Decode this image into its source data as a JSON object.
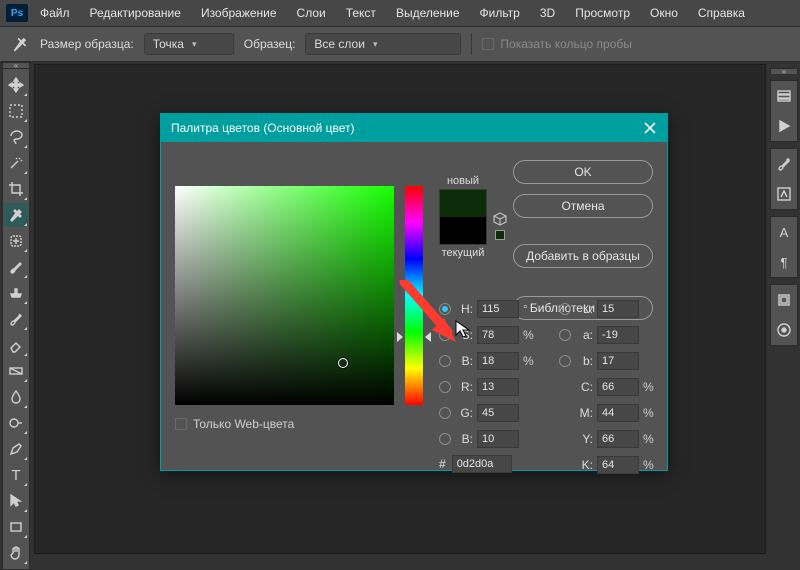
{
  "menubar": {
    "logo": "Ps",
    "items": [
      "Файл",
      "Редактирование",
      "Изображение",
      "Слои",
      "Текст",
      "Выделение",
      "Фильтр",
      "3D",
      "Просмотр",
      "Окно",
      "Справка"
    ]
  },
  "optionsbar": {
    "sample_size_label": "Размер образца:",
    "sample_size_value": "Точка",
    "sample_label": "Образец:",
    "sample_value": "Все слои",
    "show_ring_label": "Показать кольцо пробы"
  },
  "dialog": {
    "title": "Палитра цветов (Основной цвет)",
    "new_label": "новый",
    "current_label": "текущий",
    "buttons": {
      "ok": "OK",
      "cancel": "Отмена",
      "add_swatch": "Добавить в образцы",
      "color_libs": "Библиотеки цветов"
    },
    "web_only": "Только Web-цвета",
    "fields": {
      "H": {
        "label": "H:",
        "value": "115",
        "unit": "°"
      },
      "S": {
        "label": "S:",
        "value": "78",
        "unit": "%"
      },
      "Bv": {
        "label": "B:",
        "value": "18",
        "unit": "%"
      },
      "R": {
        "label": "R:",
        "value": "13"
      },
      "G": {
        "label": "G:",
        "value": "45"
      },
      "Bc": {
        "label": "B:",
        "value": "10"
      },
      "L": {
        "label": "L:",
        "value": "15"
      },
      "a": {
        "label": "a:",
        "value": "-19"
      },
      "b": {
        "label": "b:",
        "value": "17"
      },
      "C": {
        "label": "C:",
        "value": "66",
        "unit": "%"
      },
      "M": {
        "label": "M:",
        "value": "44",
        "unit": "%"
      },
      "Y": {
        "label": "Y:",
        "value": "66",
        "unit": "%"
      },
      "K": {
        "label": "K:",
        "value": "64",
        "unit": "%"
      },
      "hex": {
        "label": "#",
        "value": "0d2d0a"
      }
    },
    "colors": {
      "new": "#0d2d0a",
      "current": "#000000"
    }
  }
}
